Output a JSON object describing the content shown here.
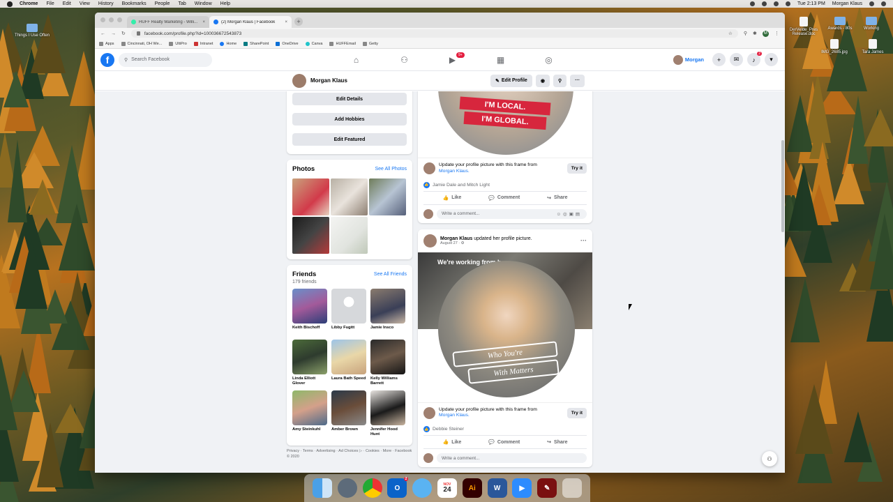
{
  "menubar": {
    "app": "Chrome",
    "items": [
      "File",
      "Edit",
      "View",
      "History",
      "Bookmarks",
      "People",
      "Tab",
      "Window",
      "Help"
    ],
    "clock": "Tue 2:13 PM",
    "user": "Morgan Klaus"
  },
  "desktop": {
    "icons": [
      "Things I Use Often",
      "DerVelde_Pres Release.doc",
      "Awards - 80s",
      "Working",
      "IMG_2685.jpg",
      "Tara James"
    ]
  },
  "browser": {
    "tabs": [
      {
        "title": "HUFF Realty Marketing - Willi...",
        "active": false
      },
      {
        "title": "(2) Morgan Klaus | Facebook",
        "active": true
      }
    ],
    "url": "facebook.com/profile.php?id=100036672543873",
    "bookmarks": [
      "Apps",
      "Cincinnati, OH We...",
      "UltiPro",
      "Intranet",
      "Home",
      "SharePoint",
      "OneDrive",
      "Canva",
      "HUFFEmail",
      "Getty"
    ]
  },
  "fb": {
    "search_placeholder": "Search Facebook",
    "watch_badge": "9+",
    "profile_name_short": "Morgan",
    "notif_badge": "2",
    "profile_name": "Morgan Klaus",
    "edit_profile": "Edit Profile"
  },
  "left": {
    "buttons": [
      "Edit Details",
      "Add Hobbies",
      "Edit Featured"
    ],
    "photos_title": "Photos",
    "see_all_photos": "See All Photos",
    "friends_title": "Friends",
    "see_all_friends": "See All Friends",
    "friends_count": "179 friends",
    "friends": [
      {
        "name": "Keith Bischoff"
      },
      {
        "name": "Libby Fugitt"
      },
      {
        "name": "Jamie Insco"
      },
      {
        "name": "Linda Elliott Glover"
      },
      {
        "name": "Laura Bath Speed"
      },
      {
        "name": "Kelly Williams Barrett"
      },
      {
        "name": "Amy Steinkuhl"
      },
      {
        "name": "Amber Brown"
      },
      {
        "name": "Jennifer Hood Hunt"
      }
    ],
    "footer": "Privacy · Terms · Advertising · Ad Choices ▷ · Cookies · More · Facebook © 2020"
  },
  "feed": {
    "post1": {
      "banner1": "I'M LOCAL.",
      "banner2": "I'M GLOBAL.",
      "frame_text": "Update your profile picture with this frame from",
      "frame_from": "Morgan Klaus.",
      "try_it": "Try it",
      "reactions": "Jamie Dale and Mitch Light",
      "like": "Like",
      "comment": "Comment",
      "share": "Share",
      "write_comment": "Write a comment..."
    },
    "post2": {
      "author": "Morgan Klaus",
      "action": "updated her profile picture.",
      "date": "August 27 · ",
      "overlay_top": "We're working from h",
      "ribbon1": "Who You're",
      "ribbon2": "With Matters",
      "frame_text": "Update your profile picture with this frame from",
      "frame_from": "Morgan Klaus.",
      "try_it": "Try it",
      "reactions": "Debbie Steiner",
      "like": "Like",
      "comment": "Comment",
      "share": "Share",
      "write_comment": "Write a comment..."
    }
  },
  "dock": {
    "mail_badge": "2",
    "calendar_month": "NOV",
    "calendar_day": "24"
  }
}
